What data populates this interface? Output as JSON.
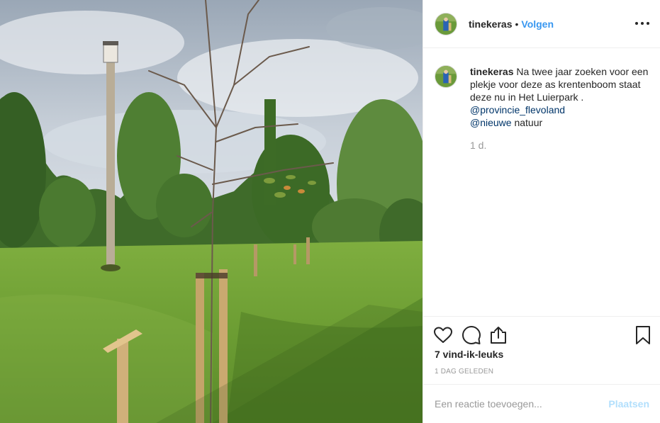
{
  "post": {
    "image_alt": "Jonge krentenboom in Het Luierpark",
    "author": "tinekeras",
    "separator": "•",
    "follow_label": "Volgen",
    "caption": {
      "username": "tinekeras",
      "text": "Na twee jaar zoeken voor een plekje voor deze as krentenboom staat deze nu in Het Luierpark .",
      "mention_1": "@provincie_flevoland",
      "mention_2": "@nieuwe",
      "trailing_text": " natuur",
      "time": "1 d."
    },
    "likes": "7 vind-ik-leuks",
    "date": "1 DAG GELEDEN",
    "comment_placeholder": "Een reactie toevoegen...",
    "post_button": "Plaatsen"
  },
  "icons": [
    "more-options-icon",
    "heart-icon",
    "comment-icon",
    "share-icon",
    "bookmark-icon"
  ],
  "colors": {
    "link": "#3897f0",
    "mention": "#003569",
    "muted": "#999999",
    "post_disabled": "#b2dffc",
    "border": "#efefef"
  }
}
